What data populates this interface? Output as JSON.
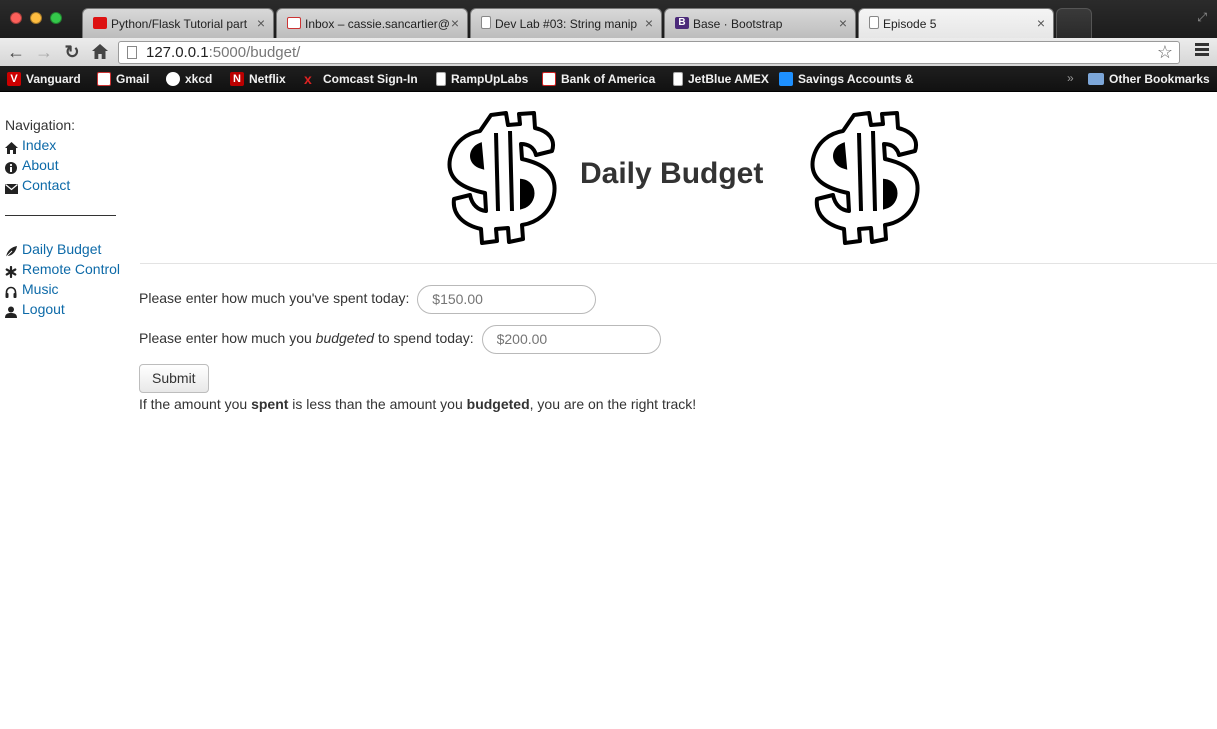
{
  "browser": {
    "tabs": [
      {
        "title": "Python/Flask Tutorial part",
        "favicon": "youtube-icon"
      },
      {
        "title": "Inbox – cassie.sancartier@",
        "favicon": "gmail-icon"
      },
      {
        "title": "Dev Lab #03: String manip",
        "favicon": "document-icon"
      },
      {
        "title": "Base · Bootstrap",
        "favicon": "bootstrap-icon"
      },
      {
        "title": "Episode 5",
        "favicon": "document-icon",
        "active": true
      }
    ],
    "url_host": "127.0.0.1",
    "url_rest": ":5000/budget/",
    "bookmarks": [
      {
        "label": "Vanguard",
        "icon": "vanguard-icon"
      },
      {
        "label": "Gmail",
        "icon": "gmail-icon"
      },
      {
        "label": "xkcd",
        "icon": "xkcd-icon"
      },
      {
        "label": "Netflix",
        "icon": "netflix-icon"
      },
      {
        "label": "Comcast Sign-In",
        "icon": "comcast-icon"
      },
      {
        "label": "RampUpLabs",
        "icon": "document-icon"
      },
      {
        "label": "Bank of America",
        "icon": "boa-icon"
      },
      {
        "label": "JetBlue AMEX",
        "icon": "document-icon"
      },
      {
        "label": "Savings Accounts & C",
        "icon": "savings-icon"
      }
    ],
    "bookmarks_more": "»",
    "other_bookmarks": "Other Bookmarks"
  },
  "sidebar": {
    "heading": "Navigation:",
    "links_top": [
      {
        "label": "Index",
        "icon": "home-icon"
      },
      {
        "label": "About",
        "icon": "info-icon"
      },
      {
        "label": "Contact",
        "icon": "envelope-icon"
      }
    ],
    "links_bottom": [
      {
        "label": "Daily Budget",
        "icon": "leaf-icon"
      },
      {
        "label": "Remote Control",
        "icon": "asterisk-icon"
      },
      {
        "label": "Music",
        "icon": "headphones-icon"
      },
      {
        "label": "Logout",
        "icon": "user-icon"
      }
    ]
  },
  "main": {
    "title": "Daily Budget",
    "spent_prefix": "Please enter how much you've spent today:",
    "spent_placeholder": "$150.00",
    "budget_prefix": "Please enter how much you ",
    "budget_em": "budgeted",
    "budget_suffix": " to spend today:",
    "budget_placeholder": "$200.00",
    "submit_label": "Submit",
    "hint_1": "If the amount you ",
    "hint_bold_1": "spent",
    "hint_2": " is less than the amount you ",
    "hint_bold_2": "budgeted",
    "hint_3": ", you are on the right track!"
  },
  "colors": {
    "link": "#0d6aa8",
    "text": "#333333"
  }
}
